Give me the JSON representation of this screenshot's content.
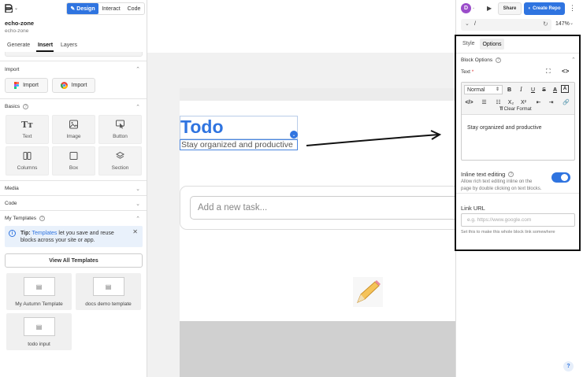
{
  "left": {
    "mode_tabs": [
      "Design",
      "Interact",
      "Code"
    ],
    "project_name": "echo-zone",
    "project_sub": "echo-zone",
    "sub_tabs": [
      "Generate",
      "Insert",
      "Layers"
    ],
    "import_section": "Import",
    "import_buttons": [
      "Import",
      "Import"
    ],
    "basics_section": "Basics",
    "basics_tiles": [
      "Text",
      "Image",
      "Button",
      "Columns",
      "Box",
      "Section"
    ],
    "media_section": "Media",
    "code_section": "Code",
    "templates_section": "My Templates",
    "tip_label": "Tip:",
    "tip_link": "Templates",
    "tip_text_1": "let you save and reuse",
    "tip_text_2": "blocks across your site or app.",
    "view_all": "View All Templates",
    "templates": [
      "My Autumn Template",
      "docs demo template",
      "todo input"
    ]
  },
  "canvas": {
    "heading": "Todo",
    "subheading": "Stay organized and productive",
    "input_placeholder": "Add a new task..."
  },
  "top": {
    "avatar_letter": "D",
    "share": "Share",
    "create": "Create Repo",
    "path": "/",
    "zoom": "147%"
  },
  "right": {
    "tabs": [
      "Style",
      "Options"
    ],
    "block_options": "Block Options",
    "text_label": "Text",
    "required_mark": "*",
    "format_select": "Normal",
    "clear_format": "Clear Format",
    "editor_text": "Stay organized and productive",
    "inline_title": "Inline text editing",
    "inline_desc_1": "Allow rich text editing inline on the",
    "inline_desc_2": "page by double clicking on text blocks.",
    "link_label": "Link URL",
    "link_placeholder": "e.g. https://www.google.com",
    "link_desc": "Set this to make this whole block link somewhere",
    "help": "?"
  },
  "colors": {
    "accent": "#2f74e0",
    "highlight_border": "#111111"
  }
}
